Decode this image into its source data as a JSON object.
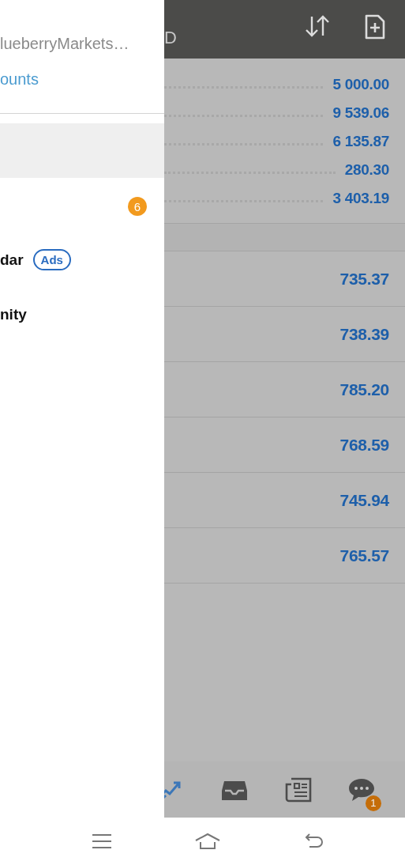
{
  "drawer": {
    "server": "lueberryMarkets…",
    "accounts_link": "ounts",
    "items": [
      {
        "selected": true
      },
      {
        "selected": false,
        "badge": "6"
      },
      {
        "selected": false,
        "label": "dar",
        "tag": "Ads"
      },
      {
        "selected": false,
        "label": "nity"
      }
    ]
  },
  "header": {
    "title": "D"
  },
  "balances": [
    "5 000.00",
    "9 539.06",
    "6 135.87",
    "280.30",
    "3 403.19"
  ],
  "positions": [
    "735.37",
    "738.39",
    "785.20",
    "768.59",
    "745.94",
    "765.57"
  ],
  "bottom_nav": [
    {
      "kind": "chart",
      "selected": true
    },
    {
      "kind": "inbox",
      "selected": false
    },
    {
      "kind": "news",
      "selected": false
    },
    {
      "kind": "chat",
      "selected": false,
      "badge": "1"
    }
  ]
}
